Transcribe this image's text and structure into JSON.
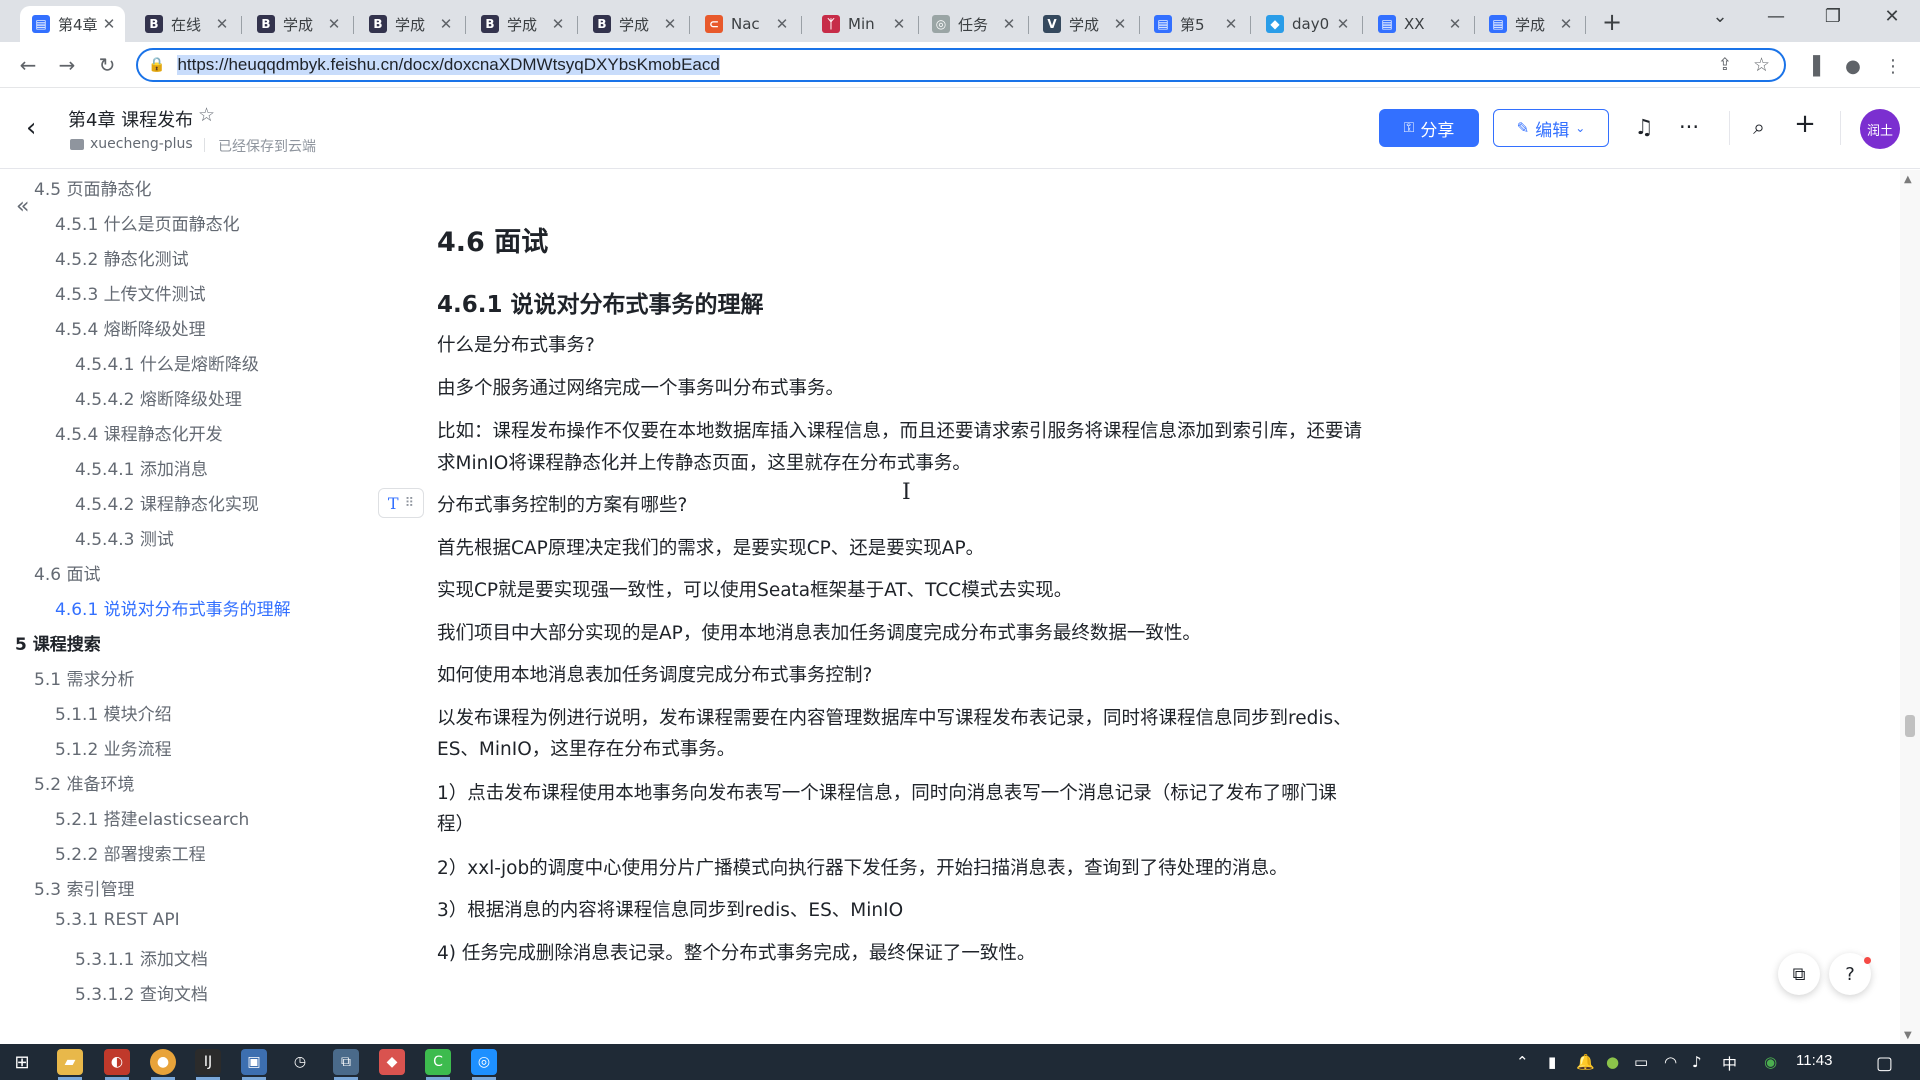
{
  "browser": {
    "tabs": [
      {
        "title": "第4章",
        "icon": "feishu-doc-icon",
        "color": "#3370ff",
        "glyph": "▤",
        "active": true
      },
      {
        "title": "在线",
        "icon": "bilibili-b-icon",
        "color": "#33334d",
        "glyph": "B"
      },
      {
        "title": "学成",
        "icon": "bilibili-b-icon",
        "color": "#33334d",
        "glyph": "B"
      },
      {
        "title": "学成",
        "icon": "bilibili-b-icon",
        "color": "#33334d",
        "glyph": "B"
      },
      {
        "title": "学成",
        "icon": "bilibili-b-icon",
        "color": "#33334d",
        "glyph": "B"
      },
      {
        "title": "学成",
        "icon": "bilibili-b-icon",
        "color": "#33334d",
        "glyph": "B"
      },
      {
        "title": "Nac",
        "icon": "nacos-icon",
        "color": "#e8592b",
        "glyph": "⊂"
      },
      {
        "title": "Min",
        "icon": "minio-icon",
        "color": "#c72c48",
        "glyph": "ᛉ"
      },
      {
        "title": "任务",
        "icon": "xxl-job-icon",
        "color": "#9aa5a5",
        "glyph": "◎"
      },
      {
        "title": "学成",
        "icon": "vue-icon",
        "color": "#35495e",
        "glyph": "V"
      },
      {
        "title": "第5",
        "icon": "feishu-doc-icon",
        "color": "#3370ff",
        "glyph": "▤"
      },
      {
        "title": "day0",
        "icon": "cloud-doc-icon",
        "color": "#2a9de8",
        "glyph": "◆"
      },
      {
        "title": "XX",
        "icon": "feishu-doc-icon",
        "color": "#3370ff",
        "glyph": "▤"
      },
      {
        "title": "学成",
        "icon": "feishu-doc-icon",
        "color": "#3370ff",
        "glyph": "▤"
      }
    ],
    "url": "https://heuqqdmbyk.feishu.cn/docx/doxcnaXDMWtsyqDXYbsKmobEacd"
  },
  "doc_header": {
    "title": "第4章 课程发布",
    "folder": "xuecheng-plus",
    "save_status": "已经保存到云端",
    "share_label": "分享",
    "edit_label": "编辑",
    "avatar_text": "润土"
  },
  "toc": [
    {
      "text": "4.5 页面静态化",
      "level": 2
    },
    {
      "text": "4.5.1 什么是页面静态化",
      "level": 3
    },
    {
      "text": "4.5.2 静态化测试",
      "level": 3
    },
    {
      "text": "4.5.3 上传文件测试",
      "level": 3
    },
    {
      "text": "4.5.4 熔断降级处理",
      "level": 3
    },
    {
      "text": "4.5.4.1 什么是熔断降级",
      "level": 4
    },
    {
      "text": "4.5.4.2 熔断降级处理",
      "level": 4
    },
    {
      "text": "4.5.4 课程静态化开发",
      "level": 3
    },
    {
      "text": "4.5.4.1 添加消息",
      "level": 4
    },
    {
      "text": "4.5.4.2 课程静态化实现",
      "level": 4
    },
    {
      "text": "4.5.4.3 测试",
      "level": 4
    },
    {
      "text": "4.6 面试",
      "level": 2
    },
    {
      "text": "4.6.1 说说对分布式事务的理解",
      "level": 3,
      "active": true
    },
    {
      "text": "5 课程搜索",
      "level": 1
    },
    {
      "text": "5.1 需求分析",
      "level": 2
    },
    {
      "text": "5.1.1 模块介绍",
      "level": 3
    },
    {
      "text": "5.1.2 业务流程",
      "level": 3
    },
    {
      "text": "5.2 准备环境",
      "level": 2
    },
    {
      "text": "5.2.1 搭建elasticsearch",
      "level": 3
    },
    {
      "text": "5.2.2 部署搜索工程",
      "level": 3
    },
    {
      "text": "5.3 索引管理",
      "level": 2
    },
    {
      "text": "5.3.1 REST API",
      "level": 3
    },
    {
      "text": "5.3.1.1 添加文档",
      "level": 4
    },
    {
      "text": "5.3.1.2 查询文档",
      "level": 4
    }
  ],
  "content": {
    "h1": "4.6 面试",
    "h2": "4.6.1 说说对分布式事务的理解",
    "paragraphs": [
      "什么是分布式事务?",
      "由多个服务通过网络完成一个事务叫分布式事务。",
      "比如：课程发布操作不仅要在本地数据库插入课程信息，而且还要请求索引服务将课程信息添加到索引库，还要请",
      "求MinIO将课程静态化并上传静态页面，这里就存在分布式事务。",
      "分布式事务控制的方案有哪些?",
      "首先根据CAP原理决定我们的需求，是要实现CP、还是要实现AP。",
      "实现CP就是要实现强一致性，可以使用Seata框架基于AT、TCC模式去实现。",
      "我们项目中大部分实现的是AP，使用本地消息表加任务调度完成分布式事务最终数据一致性。",
      "如何使用本地消息表加任务调度完成分布式事务控制?",
      "以发布课程为例进行说明，发布课程需要在内容管理数据库中写课程发布表记录，同时将课程信息同步到redis、",
      "ES、MinIO，这里存在分布式事务。",
      "1）点击发布课程使用本地事务向发布表写一个课程信息，同时向消息表写一个消息记录（标记了发布了哪门课",
      "程）",
      "2）xxl-job的调度中心使用分片广播模式向执行器下发任务，开始扫描消息表，查询到了待处理的消息。",
      "3）根据消息的内容将课程信息同步到redis、ES、MinIO",
      "4) 任务完成删除消息表记录。整个分布式事务完成，最终保证了一致性。"
    ]
  },
  "taskbar": {
    "ime": "中",
    "clock": "11:43"
  }
}
